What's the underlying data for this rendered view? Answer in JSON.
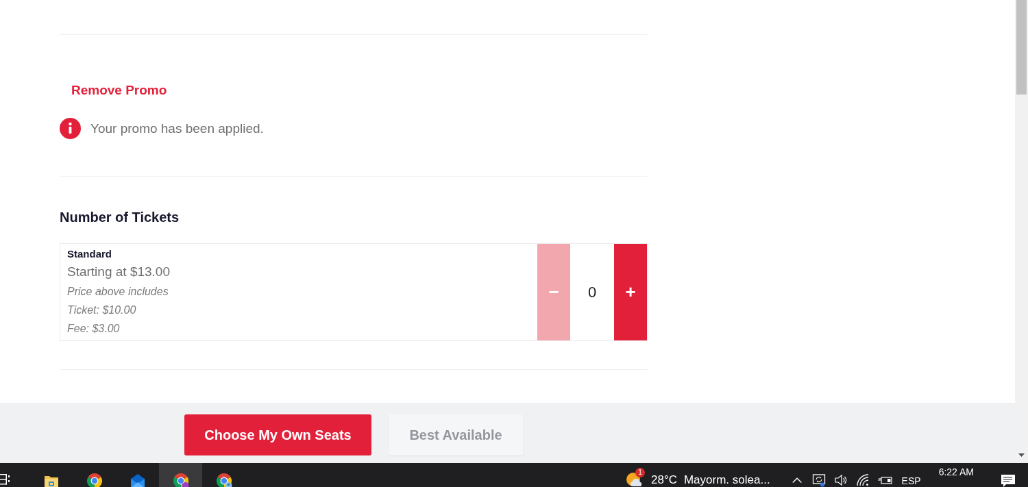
{
  "promo": {
    "remove_label": "Remove Promo",
    "message": "Your promo has been applied."
  },
  "tickets": {
    "heading": "Number of Tickets",
    "types": [
      {
        "name": "Standard",
        "price": "Starting at $13.00",
        "notes": [
          "Price above includes",
          "Ticket: $10.00",
          "Fee: $3.00"
        ],
        "decrease": {
          "symbol": "−",
          "disabled": true
        },
        "quantity": "0",
        "increase": {
          "symbol": "+",
          "disabled": false
        }
      }
    ]
  },
  "actions": [
    {
      "label": "Choose My Own Seats",
      "disabled": false
    },
    {
      "label": "Best Available",
      "disabled": true
    }
  ],
  "taskbar": {
    "apps": [
      {
        "kind": "folder",
        "selected": false
      },
      {
        "kind": "browser",
        "selected": false
      },
      {
        "kind": "mail",
        "selected": false
      },
      {
        "kind": "browser-badge",
        "selected": true
      },
      {
        "kind": "browser-profile",
        "selected": false
      }
    ],
    "weather": {
      "badge": "1",
      "temperature": "28°C",
      "condition": "Mayorm. solea..."
    },
    "language": "ESP",
    "time": "6:22 AM"
  }
}
